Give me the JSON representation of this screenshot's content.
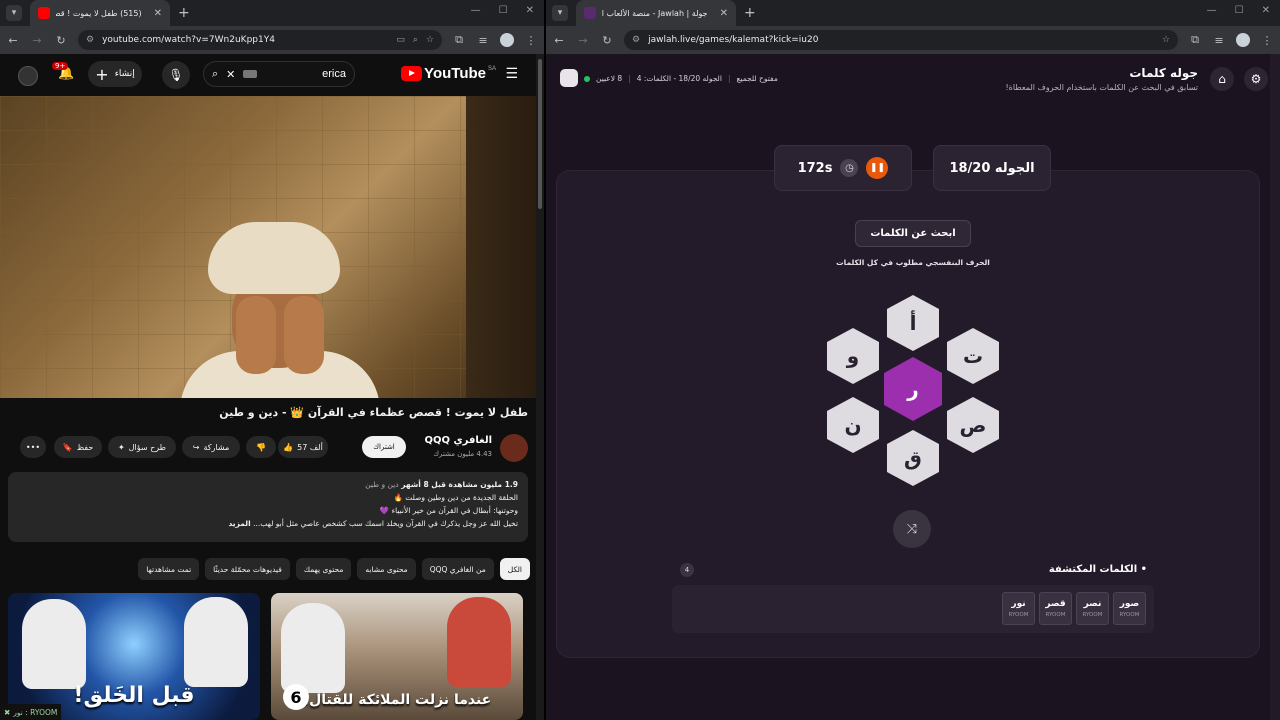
{
  "left_window": {
    "tab_title": "(515) طفل لا يموت ! قصص...",
    "url": "youtube.com/watch?v=7Wn2uKpp1Y4",
    "youtube": {
      "logo_text": "YouTube",
      "region": "SA",
      "search_query": "erica",
      "create_label": "إنشاء",
      "notif_badge": "9+",
      "video_title": "طفل لا يموت ! قصص عظماء في القرآن 👑 - دين و طين",
      "channel_name": "الغافري QQQ",
      "channel_subs": "4.43 مليون مشترك",
      "subscribe_label": "اشتراك",
      "likes_label": "57 ألف",
      "share_label": "مشاركة",
      "ask_label": "طرح سؤال",
      "save_label": "حفظ",
      "desc_views": "1.9 مليون مشاهدة  قبل 8 أشهر",
      "desc_tags": "دين و طين",
      "desc_line1": "الحلقة الجديدة من دين وطين وصلت 🔥",
      "desc_line2": "وحوتنها: أبطال في القرآن من خير الأنبياء 💜",
      "desc_line3": "تخيل الله عز وجل يذكرك في القرآن ويخلد اسمك سب كشخص عاصي مثل أبو لهب...",
      "desc_more": "المزيد",
      "chips": [
        "الكل",
        "من الغافري QQQ",
        "محتوى مشابه",
        "محتوى يهمك",
        "فيديوهات محمّلة حديثًا",
        "تمت مشاهدتها"
      ],
      "thumb1_caption": "قبل الخَلق!",
      "thumb2_caption": "عندما نزلت الملائكة للقتال!",
      "thumb2_badge": "6",
      "overlay_label": "نور : RYOOM"
    }
  },
  "right_window": {
    "tab_title": "جولة | Jawlah - منصة الألعاب الذ...",
    "url": "jawlah.live/games/kalemat?kick=iu20",
    "game": {
      "title": "جوله كلمات",
      "subtitle": "تسابق في البحث عن الكلمات باستخدام الحروف المعطاة!",
      "players": "8 لاعبين",
      "round_words": "الجوله 18/20 - الكلمات: 4",
      "open_label": "مفتوح للجميع",
      "round_label": "الجوله 18/20",
      "timer": "172s",
      "find_button": "ابحث عن الكلمات",
      "hint": "الحرف البنفسجي مطلوب في كل الكلمات",
      "center_letter": "ر",
      "letters": {
        "top": "أ",
        "top_right": "ت",
        "bottom_right": "ص",
        "bottom": "ق",
        "bottom_left": "ن",
        "top_left": "و"
      },
      "found_title": "الكلمات المكتشفة",
      "found_count": "4",
      "found_words": [
        {
          "word": "صور",
          "by": "RYOOM"
        },
        {
          "word": "نصر",
          "by": "RYOOM"
        },
        {
          "word": "قصر",
          "by": "RYOOM"
        },
        {
          "word": "نور",
          "by": "RYOOM"
        }
      ]
    }
  },
  "colors": {
    "yt_red": "#ff0000",
    "center_hex": "#9b2fae",
    "pause": "#ea580c",
    "online": "#22c55e"
  }
}
